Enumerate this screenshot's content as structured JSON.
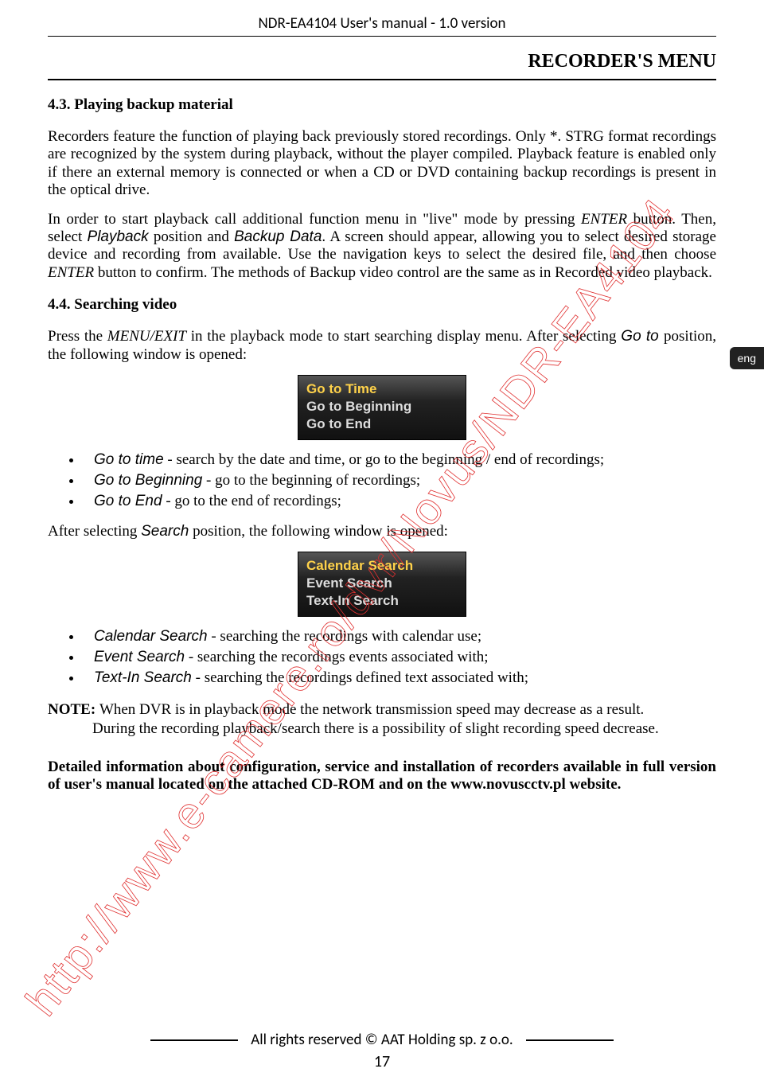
{
  "doc_header": "NDR-EA4104 User's manual - 1.0 version",
  "section_title": "RECORDER'S MENU",
  "side_tab": "eng",
  "h43": "4.3.    Playing backup material",
  "p43a": "Recorders feature the function of playing back previously stored recordings. Only *. STRG format recordings are recognized by the system during playback, without the player compiled. Playback feature is enabled only if there an external memory is connected or when a CD or DVD containing backup recordings is present in the optical drive.",
  "p43b_1": "In order to start playback call additional function menu in \"live\" mode  by pressing ",
  "p43b_enter": "ENTER",
  "p43b_2": " button. Then, select ",
  "p43b_playback": "Playback",
  "p43b_3": " position and ",
  "p43b_backup": "Backup Data",
  "p43b_4": ". A screen should appear, allowing you to select desired storage device and recording from available. Use the navigation keys to select the desired file, and then choose ",
  "p43b_5": " button to confirm. The methods of Backup video control are the same as in Recorded video playback.",
  "h44": "4.4.    Searching video",
  "p44a_1": "Press the ",
  "p44a_menuexit": "MENU/EXIT",
  "p44a_2": " in the playback mode to start searching display menu. After selecting ",
  "p44a_goto": "Go to ",
  "p44a_3": "position, the following window is opened:",
  "menu1": {
    "row1": "Go to Time",
    "row2": "Go to Beginning",
    "row3": "Go to End"
  },
  "bul1": {
    "a_label": "Go to time",
    "a_rest": " - search by the date and time, or go to the beginning / end of recordings;",
    "b_label": "Go to Beginning",
    "b_rest": " - go to the beginning of recordings;",
    "c_label": "Go to End",
    "c_rest": " - go to the end of recordings;"
  },
  "p44b_1": "After selecting ",
  "p44b_search": "Search",
  "p44b_2": " position, the following window is opened:",
  "menu2": {
    "row1": "Calendar Search",
    "row2": "Event Search",
    "row3": "Text-In Search"
  },
  "bul2": {
    "a_label": "Calendar Search",
    "a_rest": " - searching the recordings with calendar use;",
    "b_label": "Event Search",
    "b_rest": " - searching the recordings events associated with;",
    "c_label": "Text-In Search",
    "c_rest": " - searching the recordings defined text associated with;"
  },
  "note_label": "NOTE: ",
  "note_1": "When DVR is in playback mode the network transmission speed may decrease as a result.",
  "note_2": "During the recording playback/search there is a possibility of slight recording speed decrease.",
  "closing": "Detailed information about configuration, service and installation of recorders available in full version of user's manual located on the attached CD-ROM and on the www.novuscctv.pl website.",
  "footer": "All rights reserved © AAT Holding sp. z o.o.",
  "pagenum": "17",
  "watermark_text": "http://www.e-camere.ro/dvr/Novus/NDR-EA4104"
}
